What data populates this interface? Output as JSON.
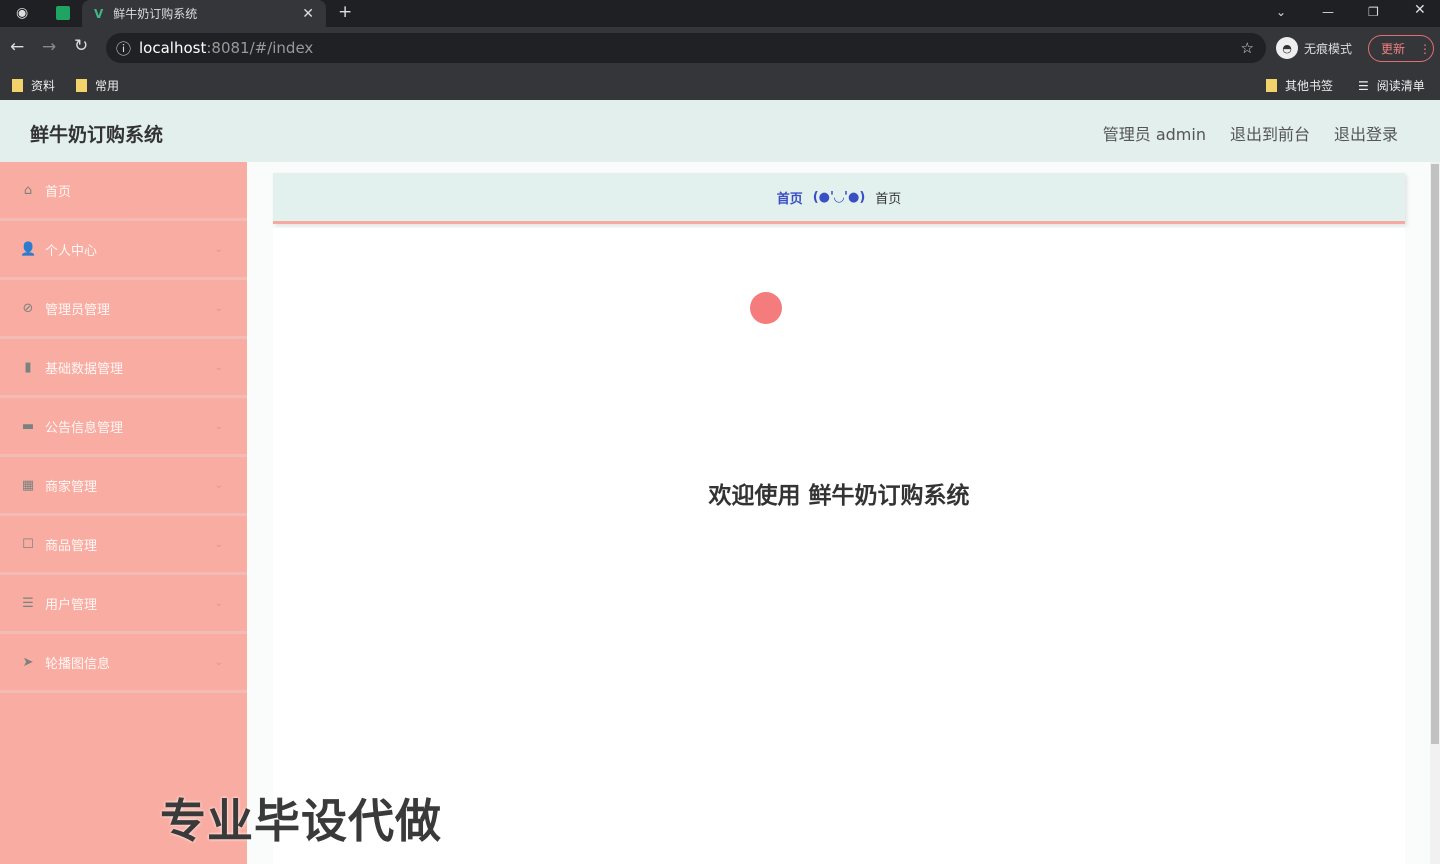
{
  "browser": {
    "tab_title": "鲜牛奶订购系统",
    "url_host": "localhost",
    "url_rest": ":8081/#/index",
    "incognito": "无痕模式",
    "update": "更新",
    "bookmarks": [
      "资料",
      "常用"
    ],
    "other_bookmarks": "其他书签",
    "reading_list": "阅读清单"
  },
  "header": {
    "title": "鲜牛奶订购系统",
    "user": "管理员 admin",
    "to_front": "退出到前台",
    "logout": "退出登录"
  },
  "sidebar": {
    "items": [
      {
        "label": "首页",
        "icon": "home-icon"
      },
      {
        "label": "个人中心",
        "icon": "user-icon"
      },
      {
        "label": "管理员管理",
        "icon": "compass-icon"
      },
      {
        "label": "基础数据管理",
        "icon": "bar-chart-icon"
      },
      {
        "label": "公告信息管理",
        "icon": "briefcase-icon"
      },
      {
        "label": "商家管理",
        "icon": "grid-icon"
      },
      {
        "label": "商品管理",
        "icon": "document-icon"
      },
      {
        "label": "用户管理",
        "icon": "menu-icon"
      },
      {
        "label": "轮播图信息",
        "icon": "send-icon"
      }
    ]
  },
  "breadcrumb": {
    "home": "首页",
    "face": "(●'◡'●)",
    "current": "首页"
  },
  "main": {
    "welcome": "欢迎使用 鲜牛奶订购系统"
  },
  "watermark": "专业毕设代做"
}
